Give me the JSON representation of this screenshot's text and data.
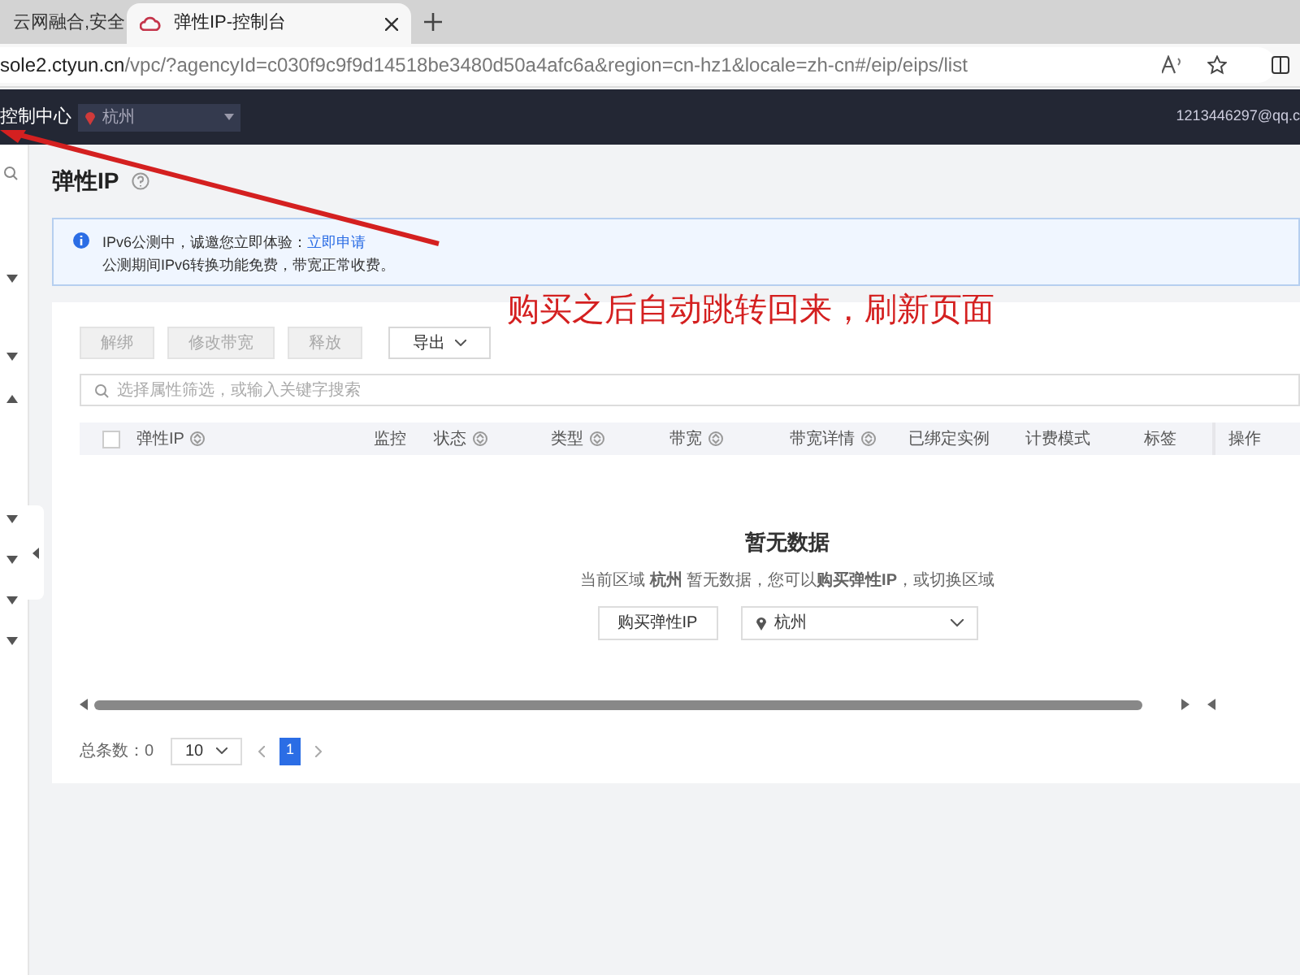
{
  "browser": {
    "tabs": [
      {
        "title": "云网融合,安全",
        "selected": false
      },
      {
        "title": "弹性IP-控制台",
        "selected": true
      }
    ],
    "url_host": "sole2.ctyun.cn",
    "url_path": "/vpc/?agencyId=c030f9c9f9d14518be3480d50a4afc6a&region=cn-hz1&locale=zh-cn#/eip/eips/list"
  },
  "header": {
    "console": "控制中心",
    "region": "杭州",
    "account": "1213446297@qq.c"
  },
  "sidebar": {
    "groups": [
      {
        "expanded": false
      },
      {
        "expanded": false
      },
      {
        "expanded": true
      },
      {
        "expanded": false
      },
      {
        "expanded": false
      },
      {
        "expanded": false
      },
      {
        "expanded": false
      }
    ]
  },
  "page": {
    "title": "弹性IP"
  },
  "notice": {
    "line1": "IPv6公测中，诚邀您立即体验：",
    "link": "立即申请",
    "line2": "公测期间IPv6转换功能免费，带宽正常收费。"
  },
  "annotation": {
    "text": "购买之后自动跳转回来，刷新页面"
  },
  "toolbar": [
    {
      "label": "解绑",
      "disabled": true,
      "kind": "button"
    },
    {
      "label": "修改带宽",
      "disabled": true,
      "kind": "button"
    },
    {
      "label": "释放",
      "disabled": true,
      "kind": "button"
    },
    {
      "label": "导出",
      "disabled": false,
      "kind": "dropdown"
    }
  ],
  "search": {
    "placeholder": "选择属性筛选，或输入关键字搜索"
  },
  "table": {
    "select_all": {
      "checked": false
    },
    "columns": [
      {
        "label": "弹性IP",
        "sortable": true
      },
      {
        "label": "监控",
        "sortable": false
      },
      {
        "label": "状态",
        "sortable": true
      },
      {
        "label": "类型",
        "sortable": true
      },
      {
        "label": "带宽",
        "sortable": true
      },
      {
        "label": "带宽详情",
        "sortable": true
      },
      {
        "label": "已绑定实例",
        "sortable": false
      },
      {
        "label": "计费模式",
        "sortable": false
      },
      {
        "label": "标签",
        "sortable": false
      },
      {
        "label": "操作",
        "sortable": false
      }
    ]
  },
  "empty": {
    "title": "暂无数据",
    "message": "当前区域 **杭州** 暂无数据，您可以**购买弹性IP**，或切换区域",
    "button": "购买弹性IP",
    "region": "杭州"
  },
  "pagination": {
    "total": "总条数：0",
    "page_size": "10",
    "pages": [
      {
        "label": "1",
        "selected": true
      }
    ]
  }
}
